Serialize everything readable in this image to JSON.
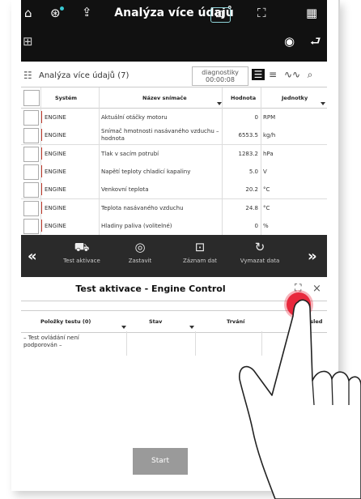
{
  "topbar": {
    "title": "Analýza více údajů",
    "icons": [
      "home-icon",
      "vci-icon",
      "export-icon",
      "diag-icon",
      "fullscreen-icon",
      "grid-icon",
      "car-scan-icon",
      "wave-icon",
      "exit-icon"
    ],
    "home_glyph": "⌂",
    "vci_glyph": "⊛",
    "export_glyph": "⇪",
    "diag_glyph": "⊡",
    "fullscreen_glyph": "⛶",
    "grid_glyph": "▦",
    "car_glyph": "⊞",
    "wave_glyph": "◉",
    "exit_glyph": "⮐"
  },
  "subheader": {
    "label": "Analýza více údajů (7)",
    "status_line1": "diagnostiky",
    "status_line2": "00:00:08",
    "view_glyphs": [
      "☰",
      "≡",
      "∿∿",
      "⌕"
    ]
  },
  "table": {
    "headers": {
      "system": "Systém",
      "name": "Název snímače",
      "value": "Hodnota",
      "unit": "Jednotky"
    },
    "rows": [
      {
        "system": "ENGINE",
        "name": "Aktuální otáčky motoru",
        "value": "0",
        "unit": "RPM"
      },
      {
        "system": "ENGINE",
        "name": "Snímač hmotnosti nasávaného vzduchu – hodnota",
        "value": "6553.5",
        "unit": "kg/h"
      },
      {
        "system": "ENGINE",
        "name": "Tlak v sacím potrubí",
        "value": "1283.2",
        "unit": "hPa"
      },
      {
        "system": "ENGINE",
        "name": "Napětí teploty chladicí kapaliny",
        "value": "5.0",
        "unit": "V"
      },
      {
        "system": "ENGINE",
        "name": "Venkovní teplota",
        "value": "20.2",
        "unit": "°C"
      },
      {
        "system": "ENGINE",
        "name": "Teplota nasávaného vzduchu",
        "value": "24.8",
        "unit": "°C"
      },
      {
        "system": "ENGINE",
        "name": "Hladiny paliva (volitelné)",
        "value": "0",
        "unit": "%"
      }
    ]
  },
  "actionbar": {
    "left_arrow": "«",
    "right_arrow": "»",
    "items": [
      {
        "label": "Test aktivace",
        "glyph": "⛟"
      },
      {
        "label": "Zastavit",
        "glyph": "◎"
      },
      {
        "label": "Záznam dat",
        "glyph": "⊡"
      },
      {
        "label": "Vymazat data",
        "glyph": "↻"
      }
    ]
  },
  "panel": {
    "title": "Test aktivace - Engine Control",
    "close": "×",
    "expand": "⛶",
    "headers": {
      "items": "Položky testu (0)",
      "state": "Stav",
      "duration": "Trvání",
      "result": "Výsled"
    },
    "empty_text": "– Test ovládání není podporován –",
    "start_label": "Start"
  },
  "colors": {
    "topbar": "#111111",
    "actionbar": "#2a2a2a",
    "system_marker": "#c0392b",
    "touch": "#e8283c",
    "start_button": "#9a9a9a"
  }
}
